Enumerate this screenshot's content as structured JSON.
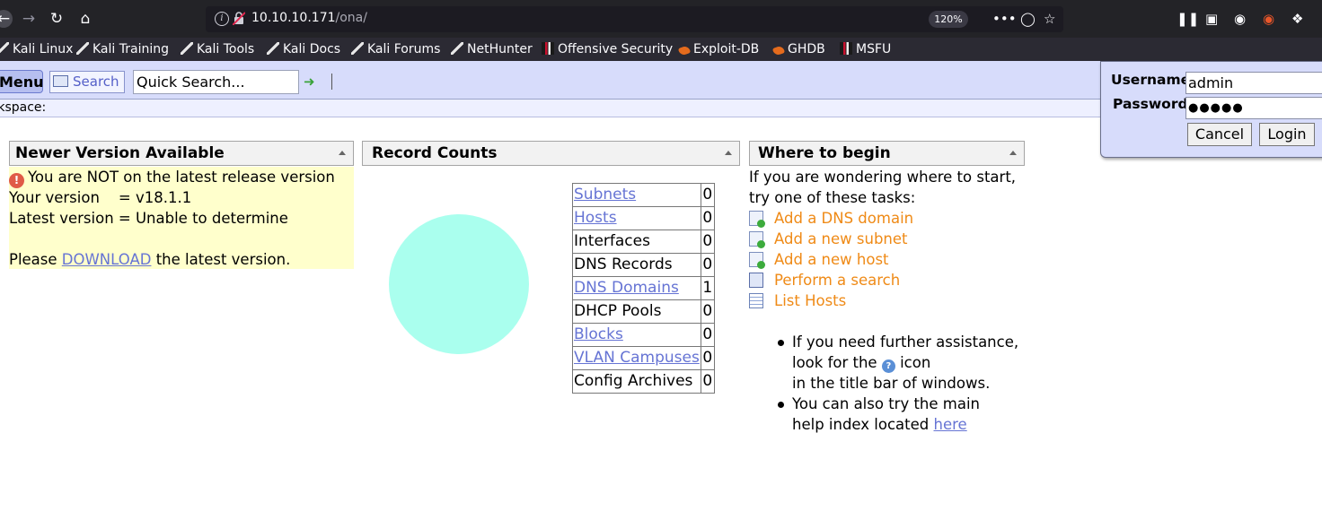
{
  "browser": {
    "url_host": "10.10.10.171",
    "url_path": "/ona/",
    "zoom": "120%",
    "bookmarks": [
      "Kali Linux",
      "Kali Training",
      "Kali Tools",
      "Kali Docs",
      "Kali Forums",
      "NetHunter",
      "Offensive Security",
      "Exploit-DB",
      "GHDB",
      "MSFU"
    ]
  },
  "menubar": {
    "menu_label": "Menu",
    "search_label": "Search",
    "quick_search_value": "Quick Search...",
    "workspace_label": "Workspace:"
  },
  "login": {
    "username_label": "Username",
    "password_label": "Password",
    "username_value": "admin",
    "password_value": "●●●●●",
    "cancel_label": "Cancel",
    "login_label": "Login"
  },
  "version_panel": {
    "title": "Newer Version Available",
    "warning": "You are NOT on the latest release version",
    "your_version": "Your version    = v18.1.1",
    "latest_version": "Latest version = Unable to determine",
    "please": "Please",
    "download_link": "DOWNLOAD",
    "after_link": "the latest version."
  },
  "counts_panel": {
    "title": "Record Counts",
    "rows": [
      {
        "label": "Subnets",
        "count": "0",
        "link": true
      },
      {
        "label": "Hosts",
        "count": "0",
        "link": true
      },
      {
        "label": "Interfaces",
        "count": "0",
        "link": false
      },
      {
        "label": "DNS Records",
        "count": "0",
        "link": false
      },
      {
        "label": "DNS Domains",
        "count": "1",
        "link": true
      },
      {
        "label": "DHCP Pools",
        "count": "0",
        "link": false
      },
      {
        "label": "Blocks",
        "count": "0",
        "link": true
      },
      {
        "label": "VLAN Campuses",
        "count": "0",
        "link": true
      },
      {
        "label": "Config Archives",
        "count": "0",
        "link": false
      }
    ],
    "pie_color": "#aaffee"
  },
  "begin_panel": {
    "title": "Where to begin",
    "intro_line1": "If you are wondering where to start,",
    "intro_line2": "try one of these tasks:",
    "tasks": [
      "Add a DNS domain",
      "Add a new subnet",
      "Add a new host",
      "Perform a search",
      "List Hosts"
    ],
    "help1_line1": "If you need further assistance,",
    "help1_line2a": "look for the",
    "help1_line2b": "icon",
    "help1_line3": "in the title bar of windows.",
    "help2_line1": "You can also try the main",
    "help2_line2": "help index located",
    "help2_link": "here"
  },
  "colors": {
    "menubar_bg": "#d7dcfb",
    "warning_bg": "#ffffcc",
    "task_link": "#ef8a16",
    "link": "#6674d4"
  }
}
